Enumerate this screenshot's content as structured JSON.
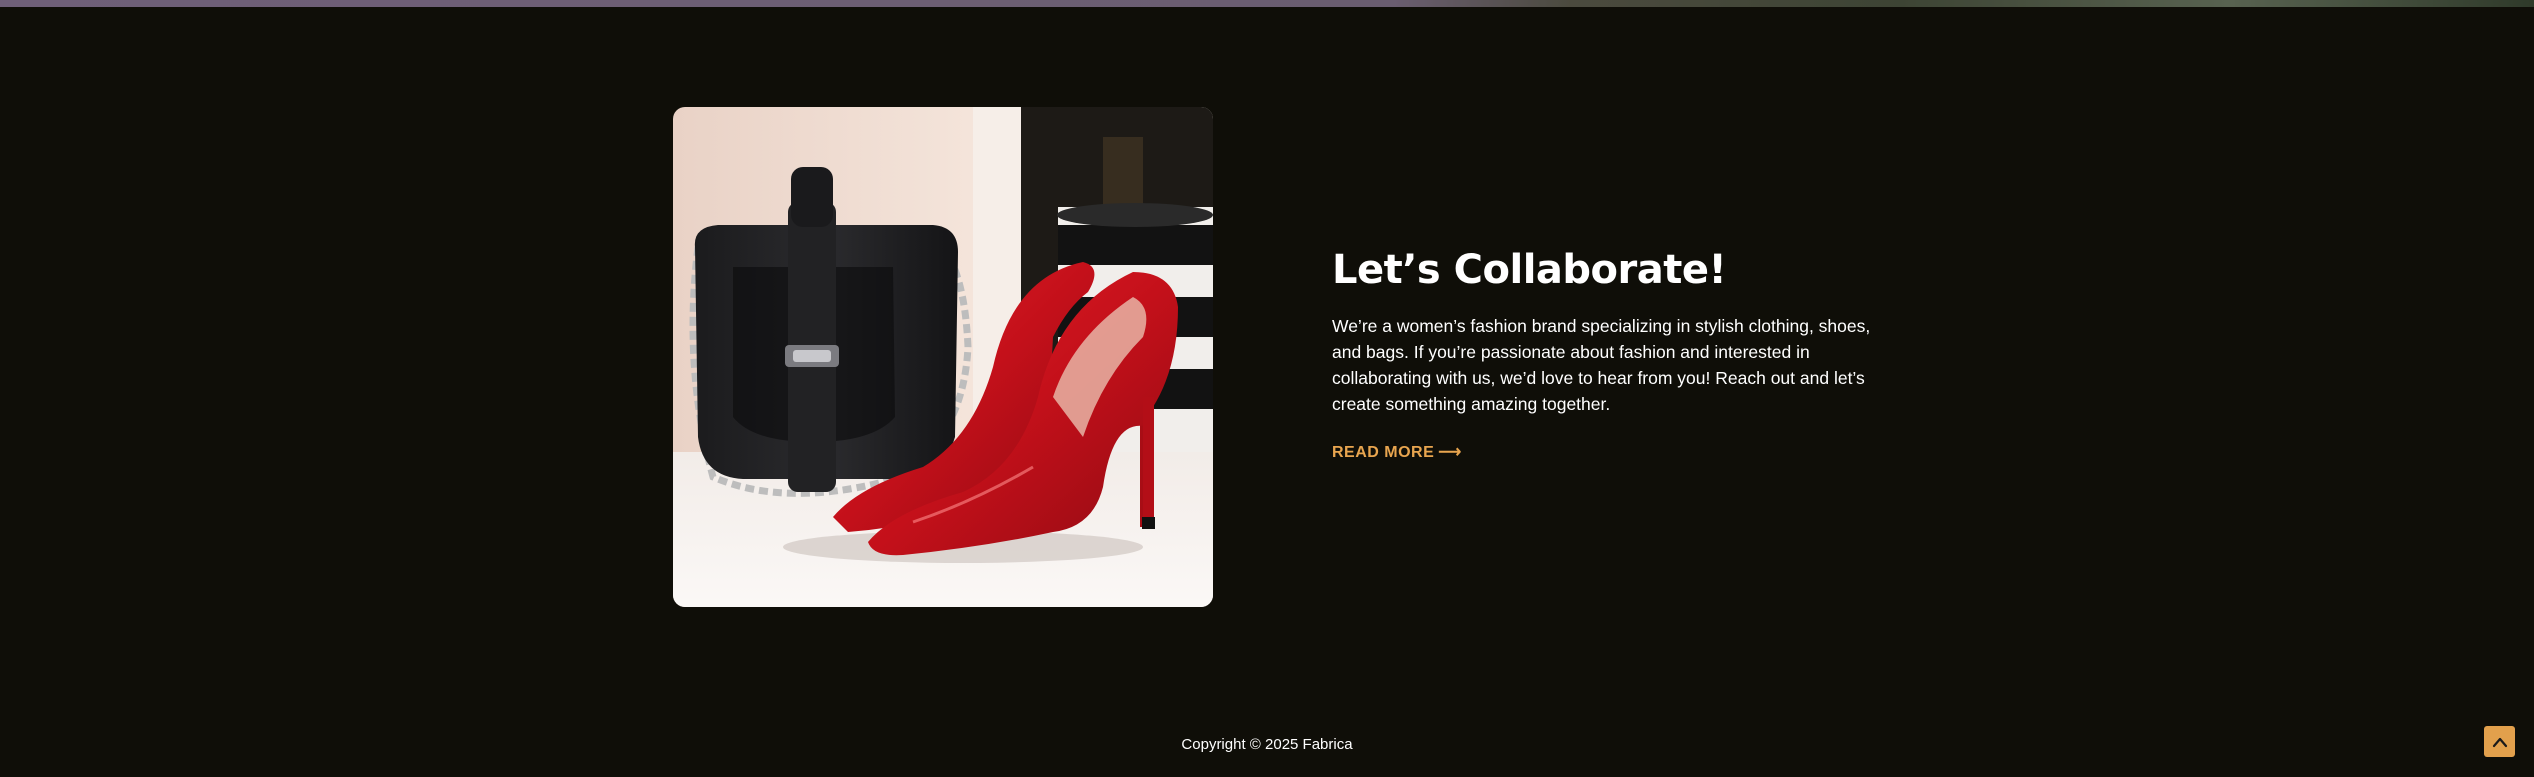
{
  "collab": {
    "heading": "Let’s Collaborate!",
    "body": "We’re a women’s fashion brand specializing in stylish clothing, shoes, and bags. If you’re passionate about fashion and interested in collaborating with us, we’d love to hear from you! Reach out and let’s create something amazing together.",
    "read_more_label": "READ MORE",
    "read_more_arrow": "⟶",
    "image_alt": "Black handbag and red high-heel shoes"
  },
  "footer": {
    "copyright": "Copyright © 2025 Fabrica"
  },
  "icons": {
    "scroll_top": "chevron-up-icon",
    "read_more": "arrow-right-icon"
  },
  "colors": {
    "background": "#0f0e08",
    "accent": "#e8a54f",
    "text": "#ffffff"
  }
}
